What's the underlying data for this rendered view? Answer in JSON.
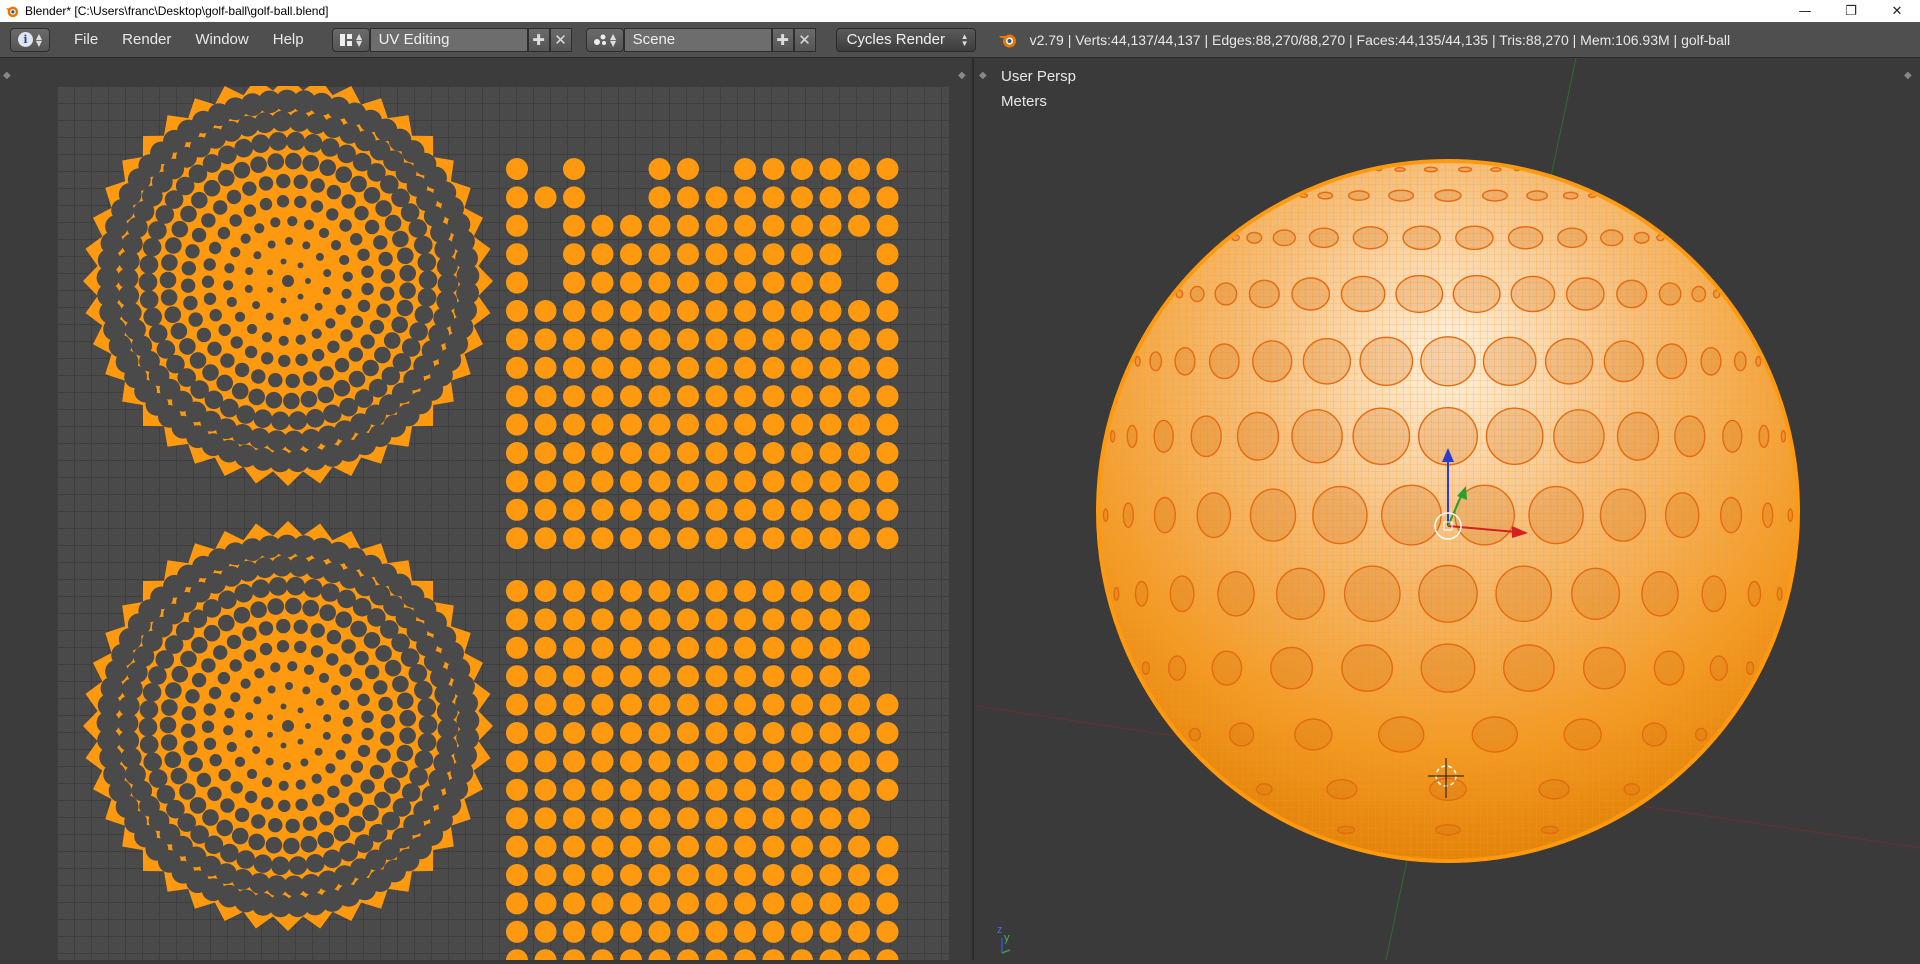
{
  "titlebar": {
    "title": "Blender* [C:\\Users\\franc\\Desktop\\golf-ball\\golf-ball.blend]",
    "minimize": "—",
    "restore": "❐",
    "close": "✕"
  },
  "header": {
    "menus": [
      "File",
      "Render",
      "Window",
      "Help"
    ],
    "screen_layout": "UV Editing",
    "scene": "Scene",
    "render_engine": "Cycles Render",
    "stats": "v2.79 | Verts:44,137/44,137 | Edges:88,270/88,270 | Faces:44,135/44,135 | Tris:88,270 | Mem:106.93M | golf-ball"
  },
  "viewport": {
    "perspective": "User Persp",
    "units": "Meters",
    "axis_z": "z",
    "axis_y": "y"
  },
  "colors": {
    "accent": "#ff8f00",
    "mesh_wire": "#ff9a10",
    "background": "#393939",
    "header": "#4f4f4f"
  }
}
